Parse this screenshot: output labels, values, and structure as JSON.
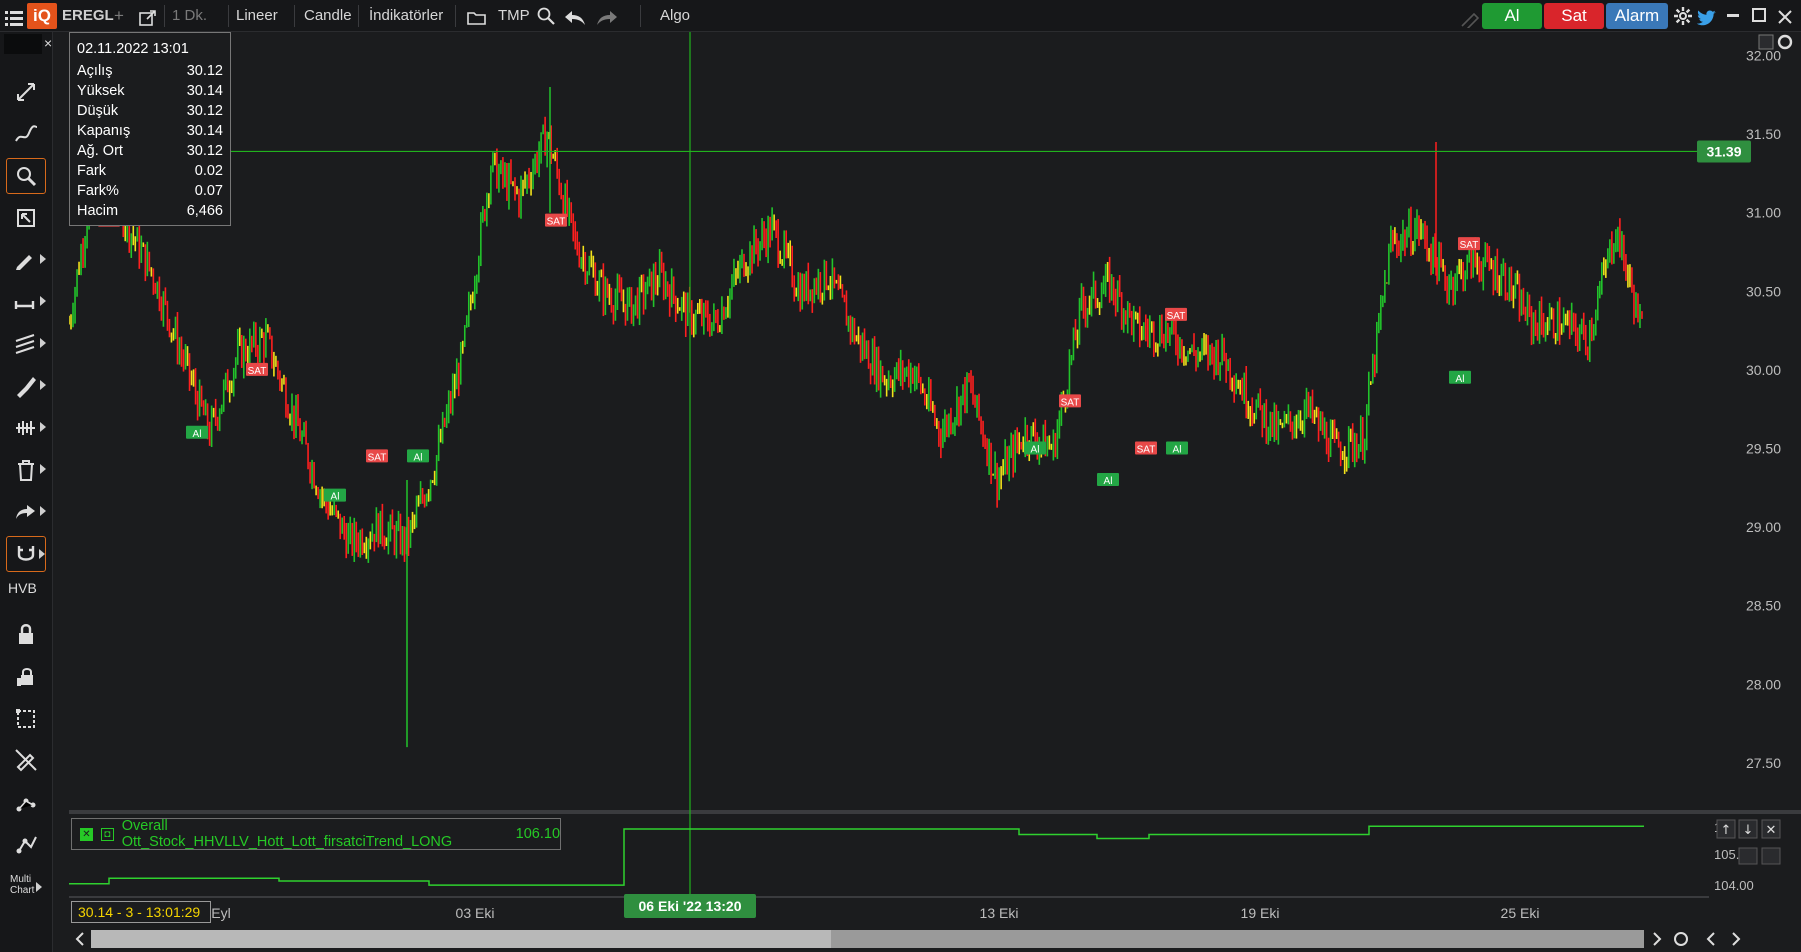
{
  "topbar": {
    "symbol": "EREGL",
    "plus": "+",
    "timeframe": "1 Dk.",
    "scale": "Lineer",
    "chart_type": "Candle",
    "indicators": "İndikatörler",
    "template": "TMP",
    "algo": "Algo",
    "buy": "Al",
    "sell": "Sat",
    "alarm": "Alarm",
    "logo": "iQ"
  },
  "leftbar": {
    "hvb": "HVB",
    "multi_chart_line1": "Multi",
    "multi_chart_line2": "Chart",
    "close": "×"
  },
  "info": {
    "date": "02.11.2022 13:01",
    "rows": [
      {
        "label": "Açılış",
        "value": "30.12"
      },
      {
        "label": "Yüksek",
        "value": "30.14"
      },
      {
        "label": "Düşük",
        "value": "30.12"
      },
      {
        "label": "Kapanış",
        "value": "30.14"
      },
      {
        "label": "Ağ. Ort",
        "value": "30.12"
      },
      {
        "label": "Fark",
        "value": "0.02"
      },
      {
        "label": "Fark%",
        "value": "0.07"
      },
      {
        "label": "Hacim",
        "value": "6,466"
      }
    ]
  },
  "price_axis": [
    "32.00",
    "31.50",
    "31.00",
    "30.50",
    "30.00",
    "29.50",
    "29.00",
    "28.50",
    "28.00",
    "27.50"
  ],
  "crosshair_price": "31.39",
  "crosshair_date": "06 Eki '22 13:20",
  "x_axis": [
    "Eyl",
    "03 Eki",
    "13 Eki",
    "19 Eki",
    "25 Eki"
  ],
  "indicator": {
    "name": "Overall Ott_Stock_HHVLLV_Hott_Lott_firsatciTrend_LONG",
    "value": "106.10",
    "axis": [
      "1",
      "105.0",
      "104.00"
    ]
  },
  "readout": "30.14 - 3 - 13:01:29",
  "signals": [
    {
      "label": "SAT"
    },
    {
      "label": "Al"
    },
    {
      "label": "SAT"
    },
    {
      "label": "Al"
    },
    {
      "label": "SAT"
    },
    {
      "label": "Al"
    },
    {
      "label": "SAT"
    },
    {
      "label": "Al"
    },
    {
      "label": "SAT"
    },
    {
      "label": "Al"
    },
    {
      "label": "SAT"
    },
    {
      "label": "Al"
    },
    {
      "label": "SAT"
    },
    {
      "label": "Al"
    },
    {
      "label": "SAT"
    }
  ],
  "colors": {
    "up": "#22c32b",
    "down": "#ff1f1f",
    "mid": "#f2e21b",
    "signal_buy": "#23a645",
    "signal_sell": "#e84848",
    "crosshair": "#21b21d",
    "buy_btn": "#1f9a33",
    "sell_btn": "#d9252b",
    "alarm_btn": "#2f6eae"
  },
  "chart_data": {
    "type": "line",
    "x": [
      "Eyl",
      "03 Eki",
      "13 Eki",
      "19 Eki",
      "25 Eki"
    ],
    "ylim": [
      27.2,
      32.15
    ],
    "series": [
      {
        "values": [
          30.3,
          31.35,
          30.95,
          30.6,
          30.1,
          29.6,
          30.1,
          30.2,
          29.7,
          29.2,
          28.9,
          29.0,
          28.9,
          29.4,
          30.1,
          31.3,
          31.1,
          31.5,
          30.8,
          30.5,
          30.4,
          30.6,
          30.35,
          30.3,
          30.7,
          30.9,
          30.5,
          30.6,
          30.2,
          29.95,
          30.0,
          29.6,
          29.9,
          29.3,
          29.6,
          29.5,
          30.4,
          30.55,
          30.25,
          30.25,
          30.1,
          30.1,
          29.8,
          29.6,
          29.75,
          29.5,
          29.55,
          30.8,
          30.9,
          30.55,
          30.7,
          30.6,
          30.3,
          30.3,
          30.2,
          30.9,
          30.2
        ]
      }
    ],
    "indicator_series": {
      "name": "Overall Ott_Stock_HHVLLV_Hott_Lott_firsatciTrend_LONG",
      "ylim": [
        103.8,
        106.5
      ],
      "values": [
        104.1,
        104.3,
        104.3,
        104.2,
        104.2,
        104.05,
        104.05,
        106.1,
        106.1,
        106.1,
        106.1,
        105.9,
        105.75,
        105.9,
        106.2,
        106.2
      ]
    }
  }
}
